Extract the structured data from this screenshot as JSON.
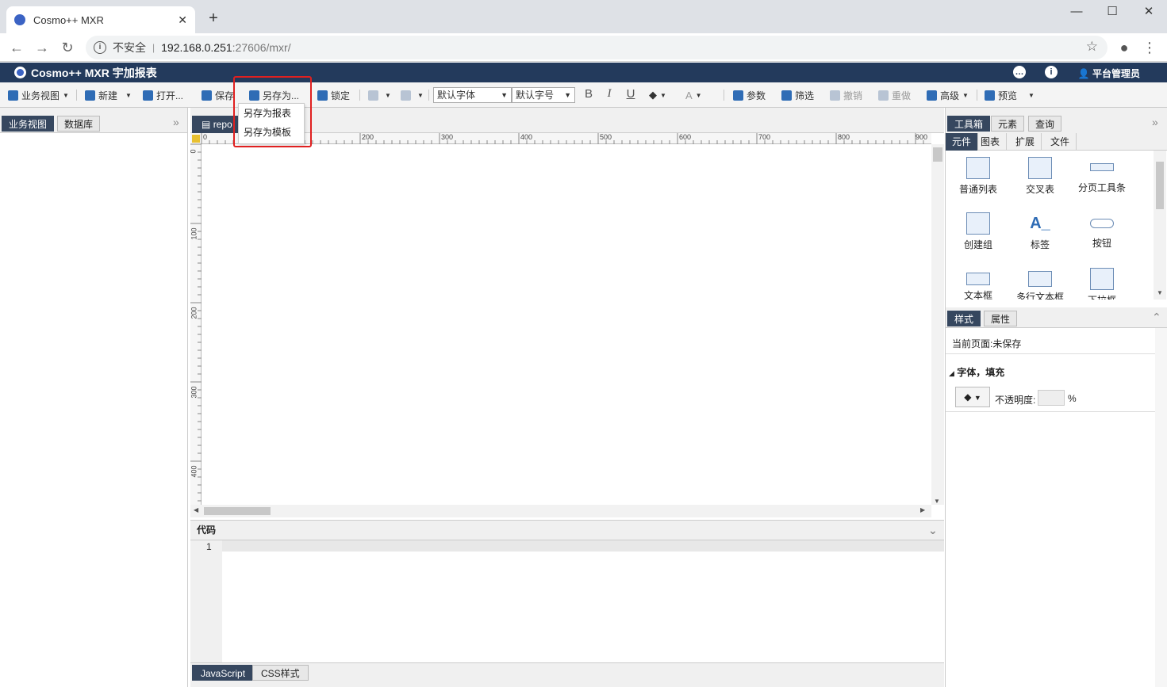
{
  "browser": {
    "tab_title": "Cosmo++ MXR",
    "address_security": "不安全",
    "address_host": "192.168.0.251",
    "address_path": ":27606/mxr/"
  },
  "app": {
    "title": "Cosmo++ MXR 宇加报表",
    "user": "平台管理员"
  },
  "toolbar": {
    "biz_view": "业务视图",
    "new": "新建",
    "open": "打开...",
    "save": "保存",
    "save_as": "另存为...",
    "lock": "锁定",
    "font": "默认字体",
    "size": "默认字号",
    "bold": "B",
    "italic": "I",
    "underline": "U",
    "params": "参数",
    "filter": "筛选",
    "undo": "撤销",
    "redo": "重做",
    "advanced": "高级",
    "preview": "预览"
  },
  "save_as_menu": [
    "另存为报表",
    "另存为模板"
  ],
  "left_panel": {
    "tabs": [
      "业务视图",
      "数据库"
    ]
  },
  "doc": {
    "tab": "repo",
    "ruler_h": [
      "0",
      "200",
      "300",
      "400",
      "500",
      "600",
      "700",
      "800",
      "900"
    ],
    "ruler_v": [
      "0",
      "100",
      "200",
      "300",
      "400"
    ]
  },
  "code": {
    "header": "代码",
    "line1": "1",
    "tabs": [
      "JavaScript",
      "CSS样式"
    ]
  },
  "right_panel": {
    "tabs": [
      "工具箱",
      "元素",
      "查询"
    ],
    "subtabs": [
      "元件",
      "图表",
      "扩展",
      "文件"
    ],
    "components": [
      "普通列表",
      "交叉表",
      "分页工具条",
      "创建组",
      "标签",
      "按钮",
      "文本框",
      "多行文本框",
      "下拉框"
    ],
    "style_tabs": [
      "样式",
      "属性"
    ],
    "current_page": "当前页面:未保存",
    "font_fill": "字体，填充",
    "opacity_label": "不透明度:",
    "percent": "%"
  }
}
